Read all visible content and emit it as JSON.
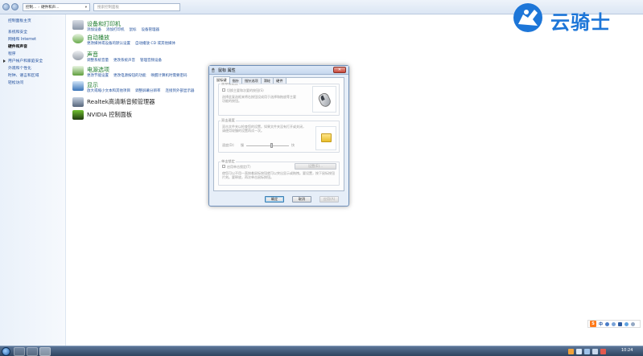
{
  "address_bar": {
    "path": [
      "控制...",
      "硬件和声..."
    ],
    "search_placeholder": "搜索控制面板"
  },
  "sidebar": {
    "items": [
      {
        "label": "控制面板主页"
      },
      {
        "label": "系统和安全"
      },
      {
        "label": "网络和 Internet"
      },
      {
        "label": "硬件和声音"
      },
      {
        "label": "程序"
      },
      {
        "label": "用户帐户和家庭安全"
      },
      {
        "label": "外观和个性化"
      },
      {
        "label": "时钟、语言和区域"
      },
      {
        "label": "轻松访问"
      }
    ]
  },
  "categories": [
    {
      "title": "设备和打印机",
      "links": [
        "添加设备",
        "添加打印机",
        "鼠标",
        "设备管理器"
      ]
    },
    {
      "title": "自动播放",
      "links": [
        "更改媒体或设备的默认设置",
        "自动播放 CD 或其他媒体"
      ]
    },
    {
      "title": "声音",
      "links": [
        "调整系统音量",
        "更改系统声音",
        "管理音频设备"
      ]
    },
    {
      "title": "电源选项",
      "links": [
        "更改节能设置",
        "更改电源按钮的功能",
        "唤醒计算机时需要密码"
      ]
    },
    {
      "title": "显示",
      "links": [
        "放大或缩小文本和其他项目",
        "调整屏幕分辨率",
        "连接到外部显示器"
      ]
    },
    {
      "title": "Realtek高清晰音频管理器",
      "links": []
    },
    {
      "title": "NVIDIA 控制面板",
      "links": []
    }
  ],
  "logo": {
    "text": "云骑士"
  },
  "dialog": {
    "title": "鼠标 属性",
    "close_label": "✕",
    "tabs": [
      "鼠标键",
      "指针",
      "指针选项",
      "滑轮",
      "硬件"
    ],
    "active_tab": 0,
    "group1": {
      "label": "鼠标键配置",
      "checkbox": "切换主要和次要的按钮(S)",
      "description": "选择此复选框来将右按钮设成用于选择和拖放等主要功能的按钮。"
    },
    "group2": {
      "label": "双击速度",
      "description": "双击文件夹以检查您的设置。如果文件夹没有打开或关闭，请使用较慢的设置再试一次。",
      "speed_label": "速度(D):",
      "slow": "慢",
      "fast": "快",
      "speed_level": 0.6
    },
    "group3": {
      "label": "单击锁定",
      "checkbox": "启用单击锁定(T)",
      "settings_button": "设置(E)...",
      "description": "使您可以不用一直按着鼠标按钮就可以突出显示或拖拽。要设置，按下鼠标按钮片刻。要释放，再次单击鼠标按钮。"
    },
    "buttons": {
      "ok": "确定",
      "cancel": "取消",
      "apply": "应用(A)"
    }
  },
  "ime": {
    "label": "中"
  },
  "taskbar": {
    "clock": "10:24"
  }
}
